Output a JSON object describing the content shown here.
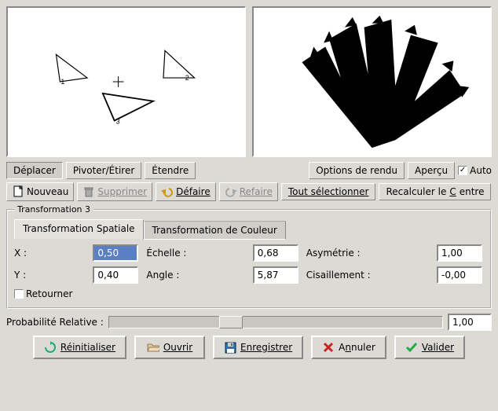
{
  "modes": {
    "move": "Déplacer",
    "rotate": "Pivoter/Étirer",
    "extend": "Étendre"
  },
  "render": {
    "options": "Options de rendu",
    "preview": "Aperçu",
    "auto": "Auto"
  },
  "toolbar": {
    "new": "Nouveau",
    "delete": "Supprimer",
    "undo": "Défaire",
    "redo": "Refaire",
    "select_all": "Tout sélectionner",
    "recenter": "Recalculer le Centre"
  },
  "panel": {
    "legend": "Transformation 3",
    "tab_spatial": "Transformation Spatiale",
    "tab_color": "Transformation de Couleur"
  },
  "fields": {
    "x_label": "X :",
    "x_value": "0,50",
    "scale_label": "Échelle :",
    "scale_value": "0,68",
    "asym_label": "Asymétrie :",
    "asym_value": "1,00",
    "y_label": "Y :",
    "y_value": "0,40",
    "angle_label": "Angle :",
    "angle_value": "5,87",
    "shear_label": "Cisaillement :",
    "shear_value": "-0,00",
    "flip": "Retourner"
  },
  "prob": {
    "label": "Probabilité Relative :",
    "value": "1,00"
  },
  "actions": {
    "reset": "Réinitialiser",
    "open": "Ouvrir",
    "save": "Enregistrer",
    "cancel": "Annuler",
    "ok": "Valider"
  }
}
